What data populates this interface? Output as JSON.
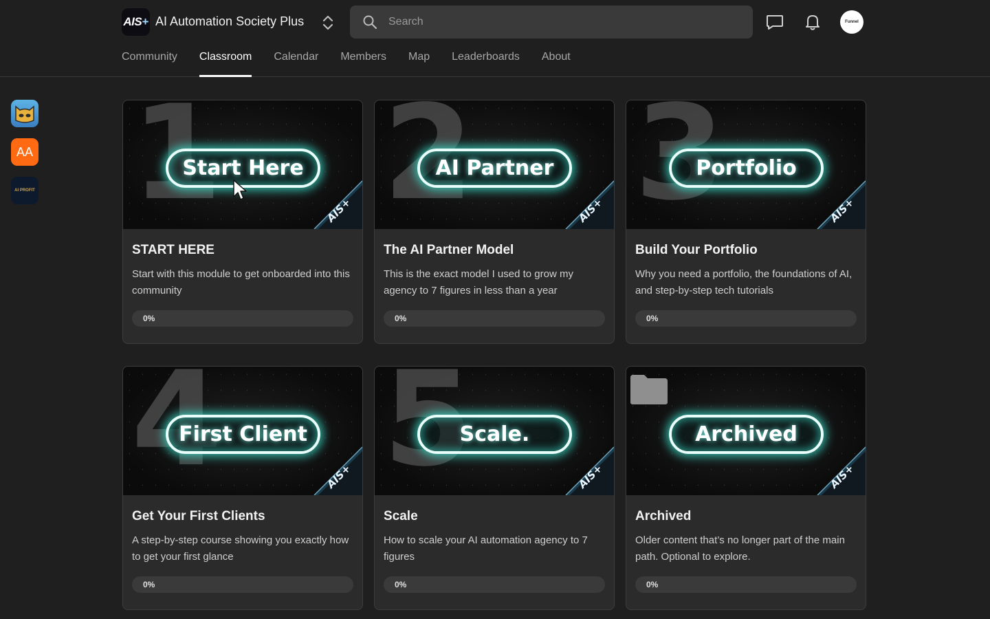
{
  "header": {
    "logo_text": "AIS",
    "logo_plus": "+",
    "site_title": "AI Automation Society Plus",
    "search_placeholder": "Search",
    "avatar_text": "Funnel"
  },
  "nav": [
    {
      "label": "Community",
      "active": false
    },
    {
      "label": "Classroom",
      "active": true
    },
    {
      "label": "Calendar",
      "active": false
    },
    {
      "label": "Members",
      "active": false
    },
    {
      "label": "Map",
      "active": false
    },
    {
      "label": "Leaderboards",
      "active": false
    },
    {
      "label": "About",
      "active": false
    }
  ],
  "rail": {
    "app2_text": "AA",
    "app3_text": "AI PROFIT"
  },
  "thumb_badge": "AIS+",
  "courses": [
    {
      "number": "1",
      "thumb_label": "Start Here",
      "title": "START HERE",
      "description": "Start with this module to get onboarded into this community",
      "progress": "0%"
    },
    {
      "number": "2",
      "thumb_label": "AI Partner",
      "title": "The AI Partner Model",
      "description": "This is the exact model I used to grow my agency to 7 figures in less than a year",
      "progress": "0%"
    },
    {
      "number": "3",
      "thumb_label": "Portfolio",
      "title": "Build Your Portfolio",
      "description": "Why you need a portfolio, the foundations of AI, and step-by-step tech tutorials",
      "progress": "0%"
    },
    {
      "number": "4",
      "thumb_label": "First Client",
      "title": "Get Your First Clients",
      "description": "A step-by-step course showing you exactly how to get your first glance",
      "progress": "0%"
    },
    {
      "number": "5",
      "thumb_label": "Scale.",
      "title": "Scale",
      "description": "How to scale your AI automation agency to 7 figures",
      "progress": "0%"
    },
    {
      "number": "",
      "thumb_label": "Archived",
      "title": "Archived",
      "description": "Older content that’s no longer part of the main path. Optional to explore.",
      "progress": "0%"
    }
  ],
  "colors": {
    "background": "#1f1f1f",
    "card": "#2b2b2b",
    "glow": "#3ce6d2"
  }
}
